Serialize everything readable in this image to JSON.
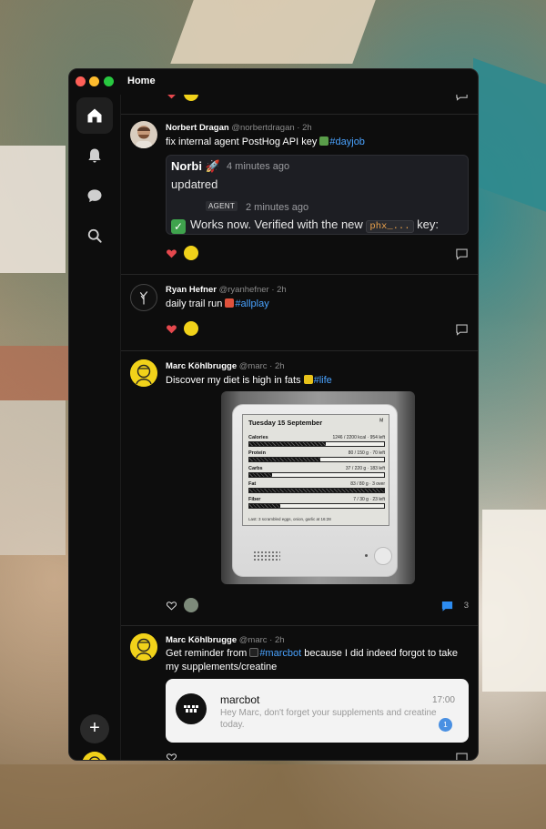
{
  "window": {
    "title": "Home"
  },
  "sidebar": {
    "items": [
      {
        "icon": "home-icon",
        "label": "Home"
      },
      {
        "icon": "bell-icon",
        "label": "Notifications"
      },
      {
        "icon": "chat-icon",
        "label": "Messages"
      },
      {
        "icon": "search-icon",
        "label": "Search"
      }
    ],
    "new_post": "+"
  },
  "posts": [
    {
      "name": "Norbert Dragan",
      "handle": "@norbertdragan",
      "time": "· 2h",
      "text": "fix internal agent PostHog API key",
      "tag": "#dayjob",
      "tag_color": "#5a9e4a",
      "embed": {
        "author": "Norbi 🚀",
        "time": "4 minutes ago",
        "message": "updatred",
        "badge": "AGENT",
        "time2": "2 minutes ago",
        "check": "✓",
        "reply_text": "Works now. Verified with the new",
        "code": "phx_...",
        "reply_suffix": "key:"
      }
    },
    {
      "name": "Ryan Hefner",
      "handle": "@ryanhefner",
      "time": "· 2h",
      "text": "daily trail run",
      "tag": "#allplay",
      "tag_color": "#e0523c"
    },
    {
      "name": "Marc Köhlbrugge",
      "handle": "@marc",
      "time": "· 2h",
      "text": "Discover my diet is high in fats",
      "tag": "#life",
      "tag_color": "#e8c21a",
      "reply_count": "3",
      "device": {
        "date": "Tuesday 15 September",
        "logo": "ᴹ",
        "rows": [
          {
            "label": "Calories",
            "value": "1246 / 2200 kcal · 954 left",
            "fill": 0.57
          },
          {
            "label": "Protein",
            "value": "80 / 150 g · 70 left",
            "fill": 0.53
          },
          {
            "label": "Carbs",
            "value": "37 / 220 g · 183 left",
            "fill": 0.17
          },
          {
            "label": "Fat",
            "value": "83 / 80 g · 3 over",
            "fill": 1.0
          },
          {
            "label": "Fiber",
            "value": "7 / 30 g · 23 left",
            "fill": 0.23
          }
        ],
        "footer": "Last: 3 scrambled eggs, onion, garlic at 16:28"
      }
    },
    {
      "name": "Marc Köhlbrugge",
      "handle": "@marc",
      "time": "· 2h",
      "text_before": "Get reminder from",
      "tag": "#marcbot",
      "text_after": "because I did indeed forgot to take my supplements/creatine",
      "notification": {
        "title": "marcbot",
        "time": "17:00",
        "text": "Hey Marc, don't forget your supplements and creatine today.",
        "badge": "1"
      }
    }
  ]
}
